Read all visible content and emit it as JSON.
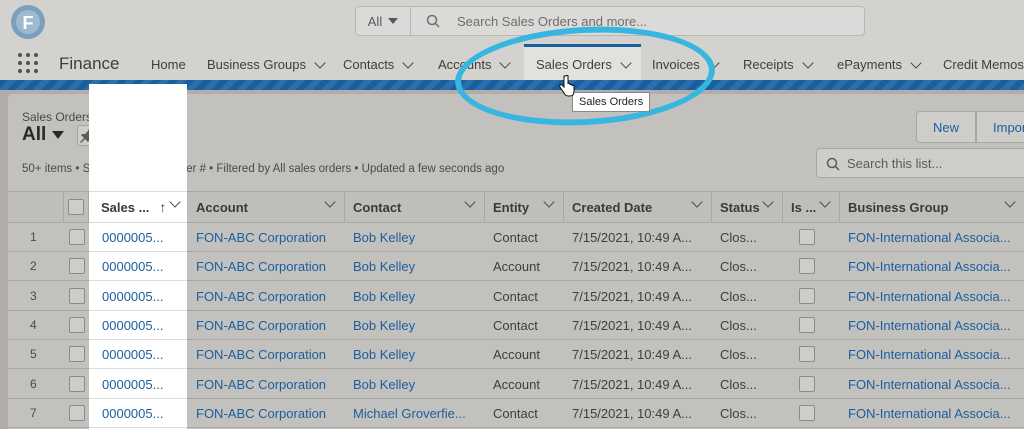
{
  "search": {
    "scope": "All",
    "placeholder": "Search Sales Orders and more..."
  },
  "nav": {
    "app_name": "Finance",
    "items": [
      {
        "label": "Home",
        "has_menu": false
      },
      {
        "label": "Business Groups",
        "has_menu": true
      },
      {
        "label": "Contacts",
        "has_menu": true
      },
      {
        "label": "Accounts",
        "has_menu": true
      },
      {
        "label": "Sales Orders",
        "has_menu": true,
        "active": true
      },
      {
        "label": "Invoices",
        "has_menu": true
      },
      {
        "label": "Receipts",
        "has_menu": true
      },
      {
        "label": "ePayments",
        "has_menu": true
      },
      {
        "label": "Credit Memos",
        "has_menu": false
      }
    ],
    "tooltip": "Sales Orders"
  },
  "list_view": {
    "object_label": "Sales Orders",
    "view_name": "All",
    "info": "50+ items • Sorted by Sales Order # • Filtered by All sales orders • Updated a few seconds ago",
    "buttons": {
      "new": "New",
      "import": "Import"
    },
    "search_placeholder": "Search this list..."
  },
  "table": {
    "columns": [
      "Sales ...",
      "Account",
      "Contact",
      "Entity",
      "Created Date",
      "Status",
      "Is ...",
      "Business Group"
    ],
    "rows": [
      {
        "num": "1",
        "sales_order": "0000005...",
        "account": "FON-ABC Corporation",
        "contact": "Bob Kelley",
        "entity": "Contact",
        "created": "7/15/2021, 10:49 A...",
        "status": "Clos...",
        "business_group": "FON-International Associa..."
      },
      {
        "num": "2",
        "sales_order": "0000005...",
        "account": "FON-ABC Corporation",
        "contact": "Bob Kelley",
        "entity": "Account",
        "created": "7/15/2021, 10:49 A...",
        "status": "Clos...",
        "business_group": "FON-International Associa..."
      },
      {
        "num": "3",
        "sales_order": "0000005...",
        "account": "FON-ABC Corporation",
        "contact": "Bob Kelley",
        "entity": "Contact",
        "created": "7/15/2021, 10:49 A...",
        "status": "Clos...",
        "business_group": "FON-International Associa..."
      },
      {
        "num": "4",
        "sales_order": "0000005...",
        "account": "FON-ABC Corporation",
        "contact": "Bob Kelley",
        "entity": "Contact",
        "created": "7/15/2021, 10:49 A...",
        "status": "Clos...",
        "business_group": "FON-International Associa..."
      },
      {
        "num": "5",
        "sales_order": "0000005...",
        "account": "FON-ABC Corporation",
        "contact": "Bob Kelley",
        "entity": "Account",
        "created": "7/15/2021, 10:49 A...",
        "status": "Clos...",
        "business_group": "FON-International Associa..."
      },
      {
        "num": "6",
        "sales_order": "0000005...",
        "account": "FON-ABC Corporation",
        "contact": "Bob Kelley",
        "entity": "Account",
        "created": "7/15/2021, 10:49 A...",
        "status": "Clos...",
        "business_group": "FON-International Associa..."
      },
      {
        "num": "7",
        "sales_order": "0000005...",
        "account": "FON-ABC Corporation",
        "contact": "Michael Groverfie...",
        "entity": "Contact",
        "created": "7/15/2021, 10:49 A...",
        "status": "Clos...",
        "business_group": "FON-International Associa..."
      }
    ]
  },
  "colors": {
    "brand": "#1b5e9e",
    "highlight": "#37b6e0",
    "overlay": "#b0adaa"
  }
}
